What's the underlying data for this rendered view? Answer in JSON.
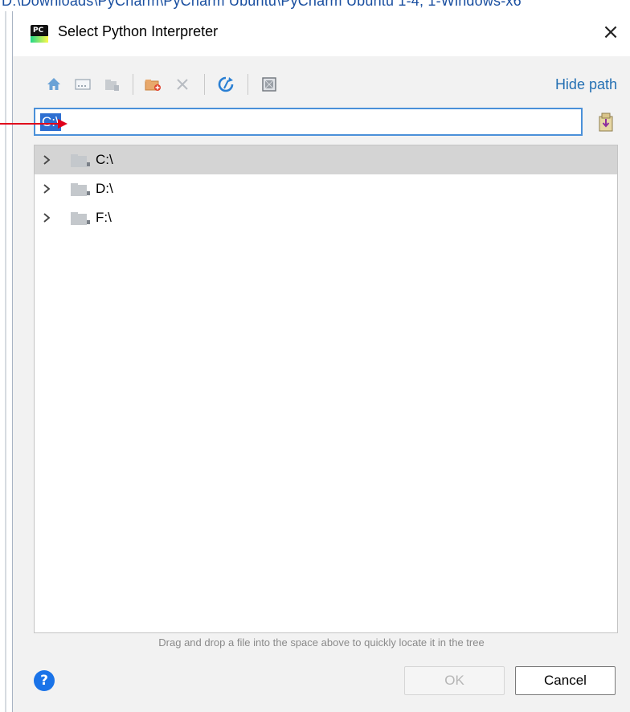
{
  "background_window": {
    "partial_title": "D:\\Downloads\\PyCharm\\PyCharm Ubuntu\\PyCharm Ubuntu 1-4, 1-Windows-x6"
  },
  "dialog": {
    "title": "Select Python Interpreter",
    "close_label": "×"
  },
  "toolbar": {
    "hide_path_label": "Hide path"
  },
  "path_input": {
    "value": "C:\\"
  },
  "tree": {
    "items": [
      {
        "label": "C:\\",
        "selected": true
      },
      {
        "label": "D:\\",
        "selected": false
      },
      {
        "label": "F:\\",
        "selected": false
      }
    ]
  },
  "footer": {
    "hint": "Drag and drop a file into the space above to quickly locate it in the tree",
    "help_label": "?",
    "ok_label": "OK",
    "cancel_label": "Cancel"
  },
  "colors": {
    "accent": "#4a90d9",
    "link": "#2470b3",
    "selection": "#2e6fd1",
    "annotation_arrow": "#e0001b"
  }
}
